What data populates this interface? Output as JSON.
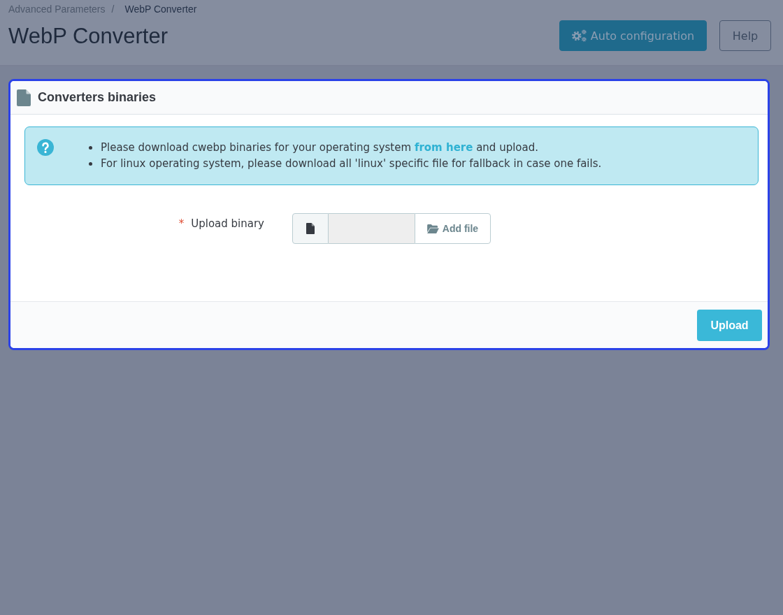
{
  "breadcrumb": {
    "items": [
      {
        "label": "Advanced Parameters",
        "current": false
      },
      {
        "label": "WebP Converter",
        "current": true
      }
    ],
    "separator": "/"
  },
  "page_title": "WebP Converter",
  "toolbar": [
    {
      "label": "Auto configuration",
      "kind": "primary"
    },
    {
      "label": "Help",
      "kind": "outline"
    }
  ],
  "card": {
    "title": "Converters binaries",
    "highlighted": true,
    "info": {
      "items": [
        {
          "text": "Please download cwebp binaries for your operating system",
          "link": "from here",
          "text_after": "and upload."
        },
        {
          "text": "For linux operating system, please download all 'linux' specific file for fallback in case one fails."
        }
      ]
    },
    "fields": [
      {
        "label": "Upload binary",
        "required_mark": "*",
        "button": "Add file"
      }
    ],
    "footer_button": "Upload"
  }
}
